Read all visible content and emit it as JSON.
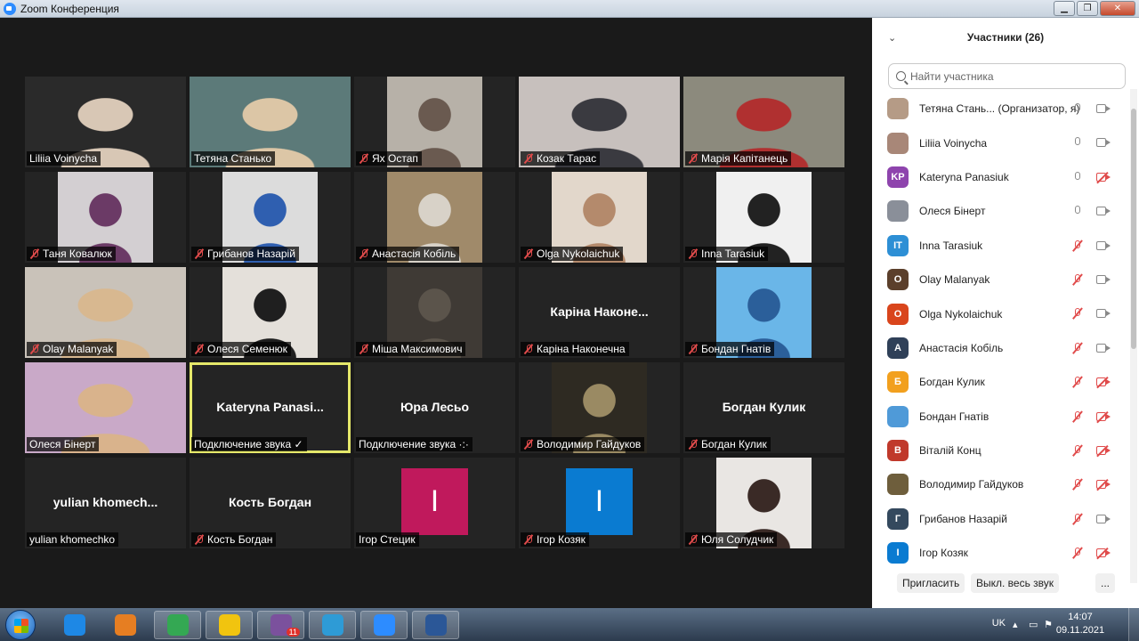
{
  "window": {
    "title": "Zoom Конференция"
  },
  "gallery": [
    {
      "name": "Liliia Voinycha",
      "muted": false,
      "video": "full",
      "bg": "#2a2a2a",
      "tone": "#d8c7b5"
    },
    {
      "name": "Тетяна Станько",
      "muted": false,
      "video": "full",
      "bg": "#5c7a79",
      "tone": "#dcc6a6"
    },
    {
      "name": "Ях Остап",
      "muted": true,
      "video": "mid",
      "bg": "#b7b1a8",
      "tone": "#6a5a50"
    },
    {
      "name": "Козак Тарас",
      "muted": true,
      "video": "full",
      "bg": "#c7c0bd",
      "tone": "#3a3a40"
    },
    {
      "name": "Марія Капітанець",
      "muted": true,
      "video": "full",
      "bg": "#8c8a7d",
      "tone": "#b03030"
    },
    {
      "name": "Таня Ковалюк",
      "muted": true,
      "video": "mid",
      "bg": "#d3cfd2",
      "tone": "#6b3a66"
    },
    {
      "name": "Грибанов Назарій",
      "muted": true,
      "video": "mid",
      "bg": "#dcdcdc",
      "tone": "#2f5fb0"
    },
    {
      "name": "Анастасія Кобіль",
      "muted": true,
      "video": "mid",
      "bg": "#a08a6a",
      "tone": "#d8d2c8"
    },
    {
      "name": "Olga Nykolaichuk",
      "muted": true,
      "video": "mid",
      "bg": "#e2d7cb",
      "tone": "#b48a6c"
    },
    {
      "name": "Inna Tarasiuk",
      "muted": true,
      "video": "mid",
      "bg": "#f0f0f0",
      "tone": "#222"
    },
    {
      "name": "Olay Malanyak",
      "muted": true,
      "video": "full",
      "bg": "#c9c2b9",
      "tone": "#d8b890"
    },
    {
      "name": "Олеся Семенюк",
      "muted": true,
      "video": "mid",
      "bg": "#e4e0da",
      "tone": "#1f1f1f"
    },
    {
      "name": "Міша Максимович",
      "muted": true,
      "video": "mid",
      "bg": "#3f3a35",
      "tone": "#5b544b"
    },
    {
      "name": "Каріна Наконечна",
      "center": "Каріна  Наконе...",
      "muted": true,
      "video": "none"
    },
    {
      "name": "Бондан Гнатів",
      "muted": true,
      "video": "mid",
      "bg": "#6ab6e8",
      "tone": "#2b5f9a"
    },
    {
      "name": "Олеся Бінерт",
      "muted": false,
      "video": "full",
      "bg": "#c9a9c8",
      "tone": "#d9b38c"
    },
    {
      "name": "Подключение звука ✓",
      "center": "Kateryna  Panasi...",
      "muted": false,
      "video": "none",
      "active": true
    },
    {
      "name": "Подключение звука ·:·",
      "center": "Юра Лесьо",
      "muted": false,
      "video": "none"
    },
    {
      "name": "Володимир Гайдуков",
      "muted": true,
      "video": "mid",
      "bg": "#2e2a22",
      "tone": "#9a8a63"
    },
    {
      "name": "Богдан Кулик",
      "center": "Богдан Кулик",
      "muted": true,
      "video": "none"
    },
    {
      "name": "yulian khomechko",
      "center": "yulian  khomech...",
      "muted": false,
      "video": "none"
    },
    {
      "name": "Кость Богдан",
      "center": "Кость Богдан",
      "muted": true,
      "video": "none"
    },
    {
      "name": "Ігор Стецик",
      "muted": false,
      "video": "avatar",
      "letter": "I",
      "color": "#c0195c"
    },
    {
      "name": "Ігор Козяк",
      "muted": true,
      "video": "avatar",
      "letter": "I",
      "color": "#0a7bd1"
    },
    {
      "name": "Юля Солудчик",
      "muted": true,
      "video": "mid",
      "bg": "#e9e6e3",
      "tone": "#3a2a26"
    }
  ],
  "panel": {
    "title": "Участники (26)",
    "search_placeholder": "Найти участника",
    "participants": [
      {
        "name": "Тетяна Стань...  (Организатор, я)",
        "avatar": "",
        "color": "#b59b86",
        "mic": "on",
        "cam": "on"
      },
      {
        "name": "Liliia Voinycha",
        "avatar": "",
        "color": "#a88778",
        "mic": "on",
        "cam": "on"
      },
      {
        "name": "Kateryna Panasiuk",
        "avatar": "KP",
        "color": "#8e44ad",
        "mic": "on",
        "cam": "off"
      },
      {
        "name": "Олеся Бінерт",
        "avatar": "",
        "color": "#8a8f99",
        "mic": "on",
        "cam": "on"
      },
      {
        "name": "Inna Tarasiuk",
        "avatar": "IT",
        "color": "#2d8fd5",
        "mic": "off",
        "cam": "on"
      },
      {
        "name": "Olay Malanyak",
        "avatar": "O",
        "color": "#5b3f2b",
        "mic": "off",
        "cam": "on"
      },
      {
        "name": "Olga Nykolaichuk",
        "avatar": "O",
        "color": "#d9451c",
        "mic": "off",
        "cam": "on"
      },
      {
        "name": "Анастасія Кобіль",
        "avatar": "A",
        "color": "#2f4058",
        "mic": "off",
        "cam": "on"
      },
      {
        "name": "Богдан Кулик",
        "avatar": "Б",
        "color": "#f2a01e",
        "mic": "off",
        "cam": "off"
      },
      {
        "name": "Бондан Гнатів",
        "avatar": "",
        "color": "#4f9ad8",
        "mic": "off",
        "cam": "off"
      },
      {
        "name": "Віталій Конц",
        "avatar": "B",
        "color": "#c0392b",
        "mic": "off",
        "cam": "off"
      },
      {
        "name": "Володимир Гайдуков",
        "avatar": "",
        "color": "#6e5e3c",
        "mic": "off",
        "cam": "off"
      },
      {
        "name": "Грибанов Назарій",
        "avatar": "Г",
        "color": "#34495e",
        "mic": "off",
        "cam": "on"
      },
      {
        "name": "Ігор Козяк",
        "avatar": "I",
        "color": "#0a7bd1",
        "mic": "off",
        "cam": "off"
      }
    ],
    "invite_label": "Пригласить",
    "mute_all_label": "Выкл. весь звук",
    "more_label": "..."
  },
  "taskbar": {
    "apps": [
      {
        "name": "ie",
        "color": "#1e88e5",
        "open": false
      },
      {
        "name": "media",
        "color": "#e67e22",
        "open": false
      },
      {
        "name": "chrome",
        "color": "#34a853",
        "open": true
      },
      {
        "name": "explorer",
        "color": "#f1c40f",
        "open": true
      },
      {
        "name": "viber",
        "color": "#7b519d",
        "open": true,
        "badge": "11"
      },
      {
        "name": "edge",
        "color": "#2e9bd6",
        "open": true
      },
      {
        "name": "zoom",
        "color": "#2d8cff",
        "open": true
      },
      {
        "name": "word",
        "color": "#2b5797",
        "open": true
      }
    ],
    "lang": "UK",
    "time": "14:07",
    "date": "09.11.2021"
  }
}
